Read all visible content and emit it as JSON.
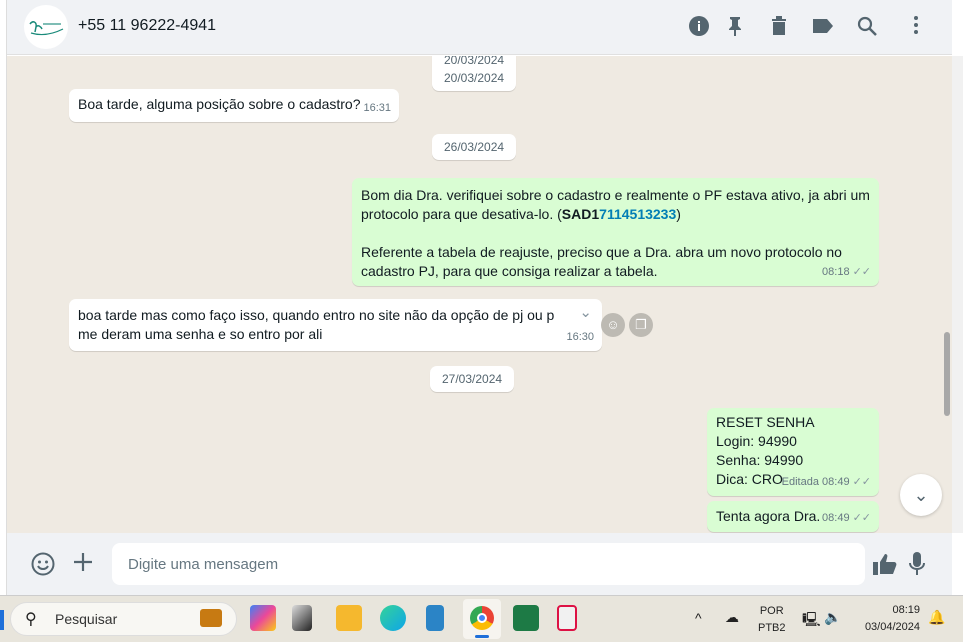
{
  "header": {
    "contact": "+55 11 96222-4941",
    "icons": [
      "info-icon",
      "pin-icon",
      "delete-icon",
      "label-icon",
      "search-icon",
      "menu-icon"
    ]
  },
  "dates": [
    "20/03/2024",
    "20/03/2024",
    "26/03/2024",
    "27/03/2024"
  ],
  "messages": [
    {
      "dir": "in",
      "text": "Boa tarde, alguma posição sobre o cadastro?",
      "time": "16:31"
    },
    {
      "dir": "out",
      "line1": "Bom dia Dra. verifiquei sobre o cadastro e realmente o PF estava ativo, ja abri um protocolo para que desativa-lo. (",
      "bold": "SAD1",
      "link": "7114513233",
      "close": ")",
      "line2": "Referente a tabela de reajuste, preciso que a Dra. abra um novo protocolo no cadastro PJ, para que consiga realizar a tabela.",
      "time": "08:18"
    },
    {
      "dir": "in",
      "text": "boa tarde mas como faço isso, quando entro no site não da opção de pj ou p",
      "text2": "me deram uma senha e so entro por ali",
      "time": "16:30"
    },
    {
      "dir": "out",
      "lines": [
        "RESET SENHA",
        "Login: 94990",
        "Senha: 94990",
        "Dica: CRO"
      ],
      "edited": "Editada",
      "time": "08:49"
    },
    {
      "dir": "out",
      "text": "Tenta agora Dra.",
      "time": "08:49"
    }
  ],
  "composer": {
    "placeholder": "Digite uma mensagem"
  },
  "taskbar": {
    "search": "Pesquisar",
    "lang1": "POR",
    "lang2": "PTB2",
    "time": "08:19",
    "date": "03/04/2024"
  }
}
